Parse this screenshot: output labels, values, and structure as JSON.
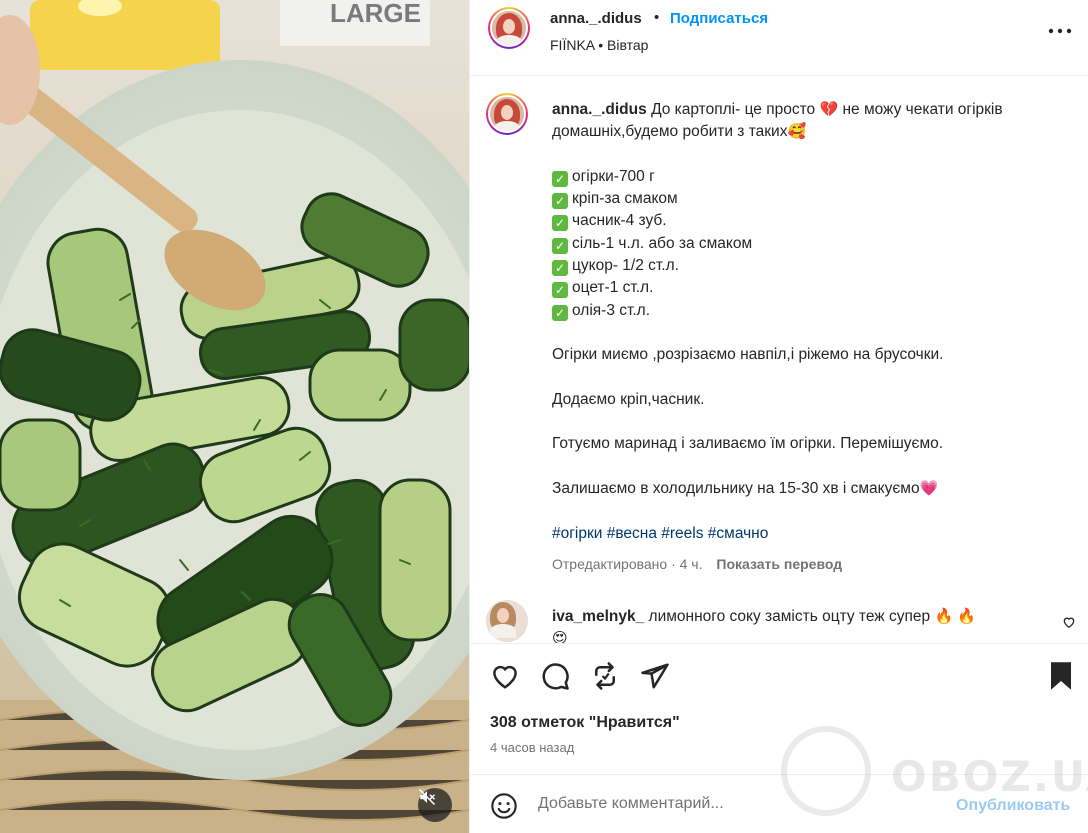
{
  "post": {
    "username": "anna._.didus",
    "follow_label": "Подписаться",
    "dot": "•",
    "audio": "FIÏNKA",
    "location_sep": "•",
    "day": "Вівтар"
  },
  "caption": {
    "username": "anna._.didus",
    "intro_1": "До картоплі- це просто",
    "intro_emoji_1": "💔",
    "intro_2": "не можу чекати огірків домашніх,будемо робити з таких",
    "intro_emoji_2": "🥰",
    "ingredients": [
      "огірки-700 г",
      "кріп-за смаком",
      "часник-4 зуб.",
      "сіль-1 ч.л. або за смаком",
      "цукор- 1/2 ст.л.",
      "оцет-1 ст.л.",
      "олія-3 ст.л."
    ],
    "check_glyph": "✓",
    "step_1": "Огірки миємо ,розрізаємо навпіл,і ріжемо на брусочки.",
    "step_2": "Додаємо кріп,часник.",
    "step_3": "Готуємо маринад і заливаємо їм огірки. Перемішуємо.",
    "step_4": "Залишаємо в холодильнику на 15-30 хв і смакуємо",
    "step_4_emoji": "💗",
    "hashtags": [
      "#огірки",
      "#весна",
      "#reels",
      "#смачно"
    ],
    "edited": "Отредактировано · 4 ч.",
    "translate": "Показать перевод"
  },
  "comment": {
    "username": "iva_melnyk_",
    "text": "лимонного соку замість оцту теж супер",
    "emojis_inline": "🔥 🔥",
    "emoji_next_line": "😍"
  },
  "actions": {
    "likes": "308 отметок \"Нравится\"",
    "time": "4 часов назад"
  },
  "comment_box": {
    "placeholder": "Добавьте комментарий...",
    "publish": "Опубликовать"
  },
  "watermark": "OBOZ.UA",
  "icons": [
    "more-icon",
    "heart-icon",
    "comment-icon",
    "repost-icon",
    "share-icon",
    "bookmark-icon",
    "emoji-icon",
    "mute-icon",
    "small-heart-icon"
  ],
  "colors": {
    "accent": "#0095f6",
    "publish_disabled": "#9ccbf2",
    "hashtag": "#00376b",
    "muted": "#737373"
  }
}
